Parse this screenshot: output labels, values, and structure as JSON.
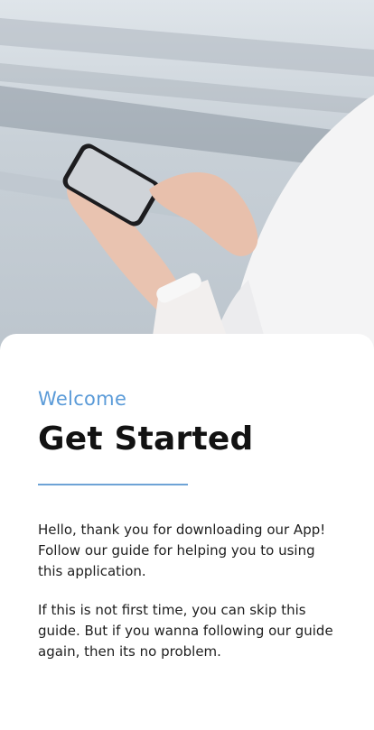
{
  "onboarding": {
    "subtitle": "Welcome",
    "title": "Get Started",
    "paragraph1": "Hello, thank you for downloading our App! Follow our guide for helping you to using this application.",
    "paragraph2": "If this is not first time, you can skip this guide. But if you wanna following our guide again, then its no problem."
  },
  "colors": {
    "accent": "#5b9bd8",
    "title": "#121212",
    "divider": "#6ea3d6"
  }
}
